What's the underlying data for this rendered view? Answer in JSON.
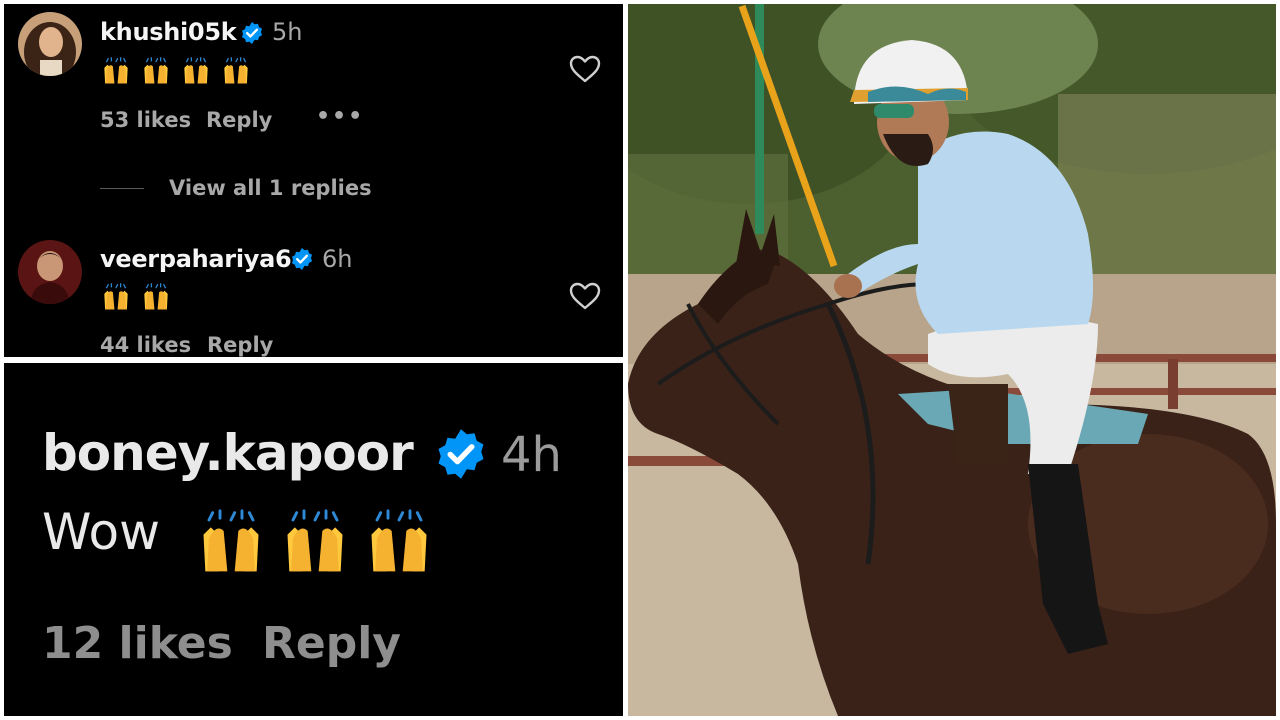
{
  "comments": [
    {
      "username": "khushi05k",
      "time": "5h",
      "emoji_count": 4,
      "likes": "53 likes",
      "reply": "Reply",
      "more": "•••",
      "view_replies": "View all 1 replies"
    },
    {
      "username": "veerpahariya6",
      "time": "6h",
      "emoji_count": 2,
      "likes": "44 likes",
      "reply": "Reply"
    }
  ],
  "featured_comment": {
    "username": "boney.kapoor",
    "time": "4h",
    "text": "Wow",
    "emoji_count": 3,
    "likes": "12 likes",
    "reply": "Reply"
  },
  "icons": {
    "verified": "verified-badge-icon",
    "like": "heart-icon",
    "emoji": "raising-hands-emoji"
  },
  "colors": {
    "background": "#000000",
    "verified_blue": "#0095f6",
    "text_primary": "#f5f5f5",
    "text_secondary": "#a8a8a8",
    "emoji_yellow": "#ffc83d"
  }
}
